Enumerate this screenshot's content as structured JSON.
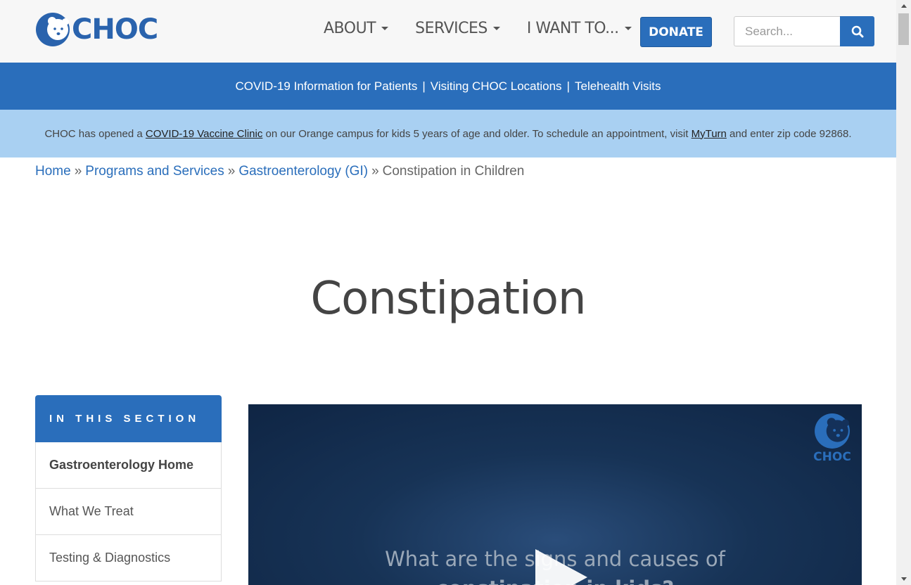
{
  "header": {
    "logo_text": "CHOC",
    "nav": [
      {
        "label": "ABOUT",
        "icon": "chevron-down-icon"
      },
      {
        "label": "SERVICES",
        "icon": "chevron-down-icon"
      },
      {
        "label": "I WANT TO...",
        "icon": "chevron-down-icon"
      }
    ],
    "donate_label": "DONATE",
    "search": {
      "placeholder": "Search...",
      "value": "",
      "button_icon": "search-icon"
    }
  },
  "covid_bar": {
    "links": [
      "COVID-19 Information for Patients",
      "Visiting CHOC Locations",
      "Telehealth Visits"
    ],
    "separator": "|"
  },
  "vaccine_bar": {
    "text_1": "CHOC has opened a ",
    "link_1": "COVID-19 Vaccine Clinic",
    "text_2": " on our Orange campus for kids 5 years of age and older. To schedule an appointment, visit ",
    "link_2": "MyTurn",
    "text_3": " and enter zip code 92868."
  },
  "breadcrumb": {
    "items": [
      "Home",
      "Programs and Services",
      "Gastroenterology (GI)"
    ],
    "current": "Constipation in Children",
    "separator": "»"
  },
  "page_title": "Constipation",
  "sidebar": {
    "heading": "IN THIS SECTION",
    "items": [
      "Gastroenterology Home",
      "What We Treat",
      "Testing & Diagnostics"
    ]
  },
  "video": {
    "logo_text": "CHOC",
    "caption_line_1": "What are the signs and causes of",
    "caption_line_2": "constipation in kids?"
  },
  "colors": {
    "brand_blue": "#2a6ebb",
    "light_blue": "#a9d0f2"
  }
}
